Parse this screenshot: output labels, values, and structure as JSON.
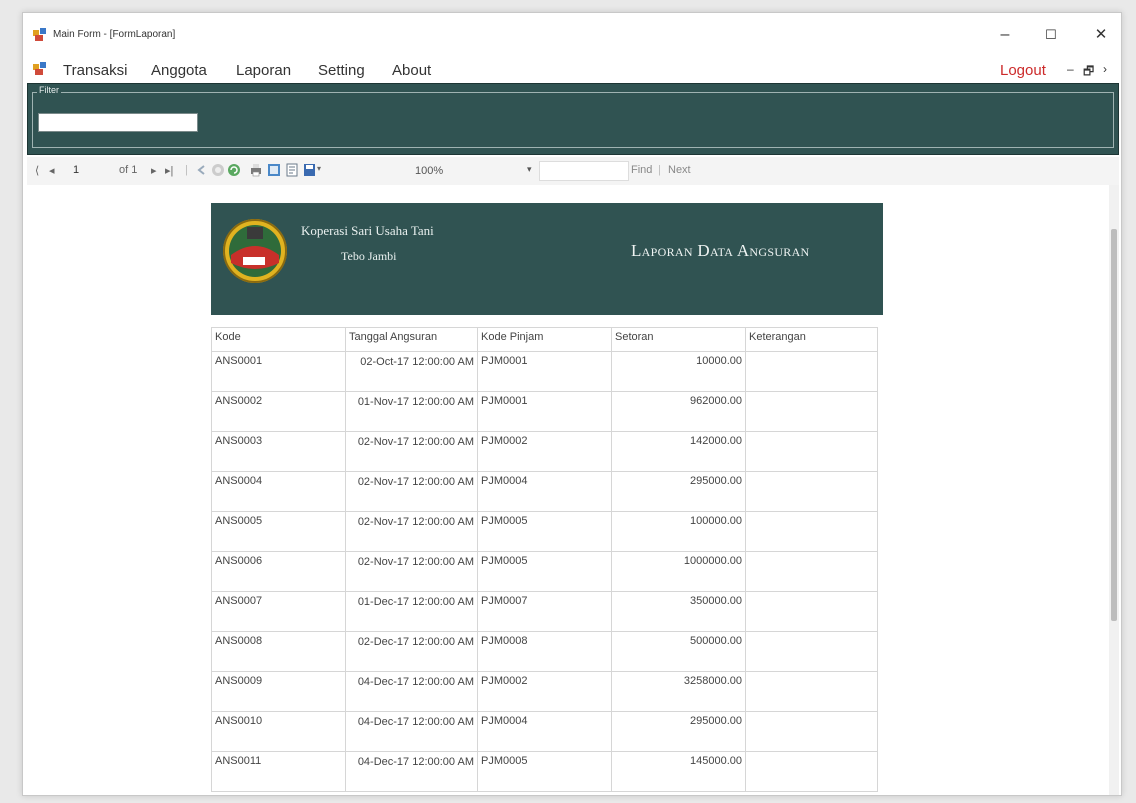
{
  "window": {
    "title": "Main Form - [FormLaporan]",
    "buttons": {
      "minimize": "–",
      "maximize": "☐",
      "close": "✕"
    }
  },
  "menu": {
    "items": [
      "Transaksi",
      "Anggota",
      "Laporan",
      "Setting",
      "About"
    ],
    "logout": "Logout",
    "mdi_controls": {
      "minimize": "–",
      "restore": "🗗",
      "close": "›"
    }
  },
  "filter": {
    "label": "Filter",
    "value": ""
  },
  "toolbar": {
    "first": "⟨",
    "prev": "◂",
    "page": "1",
    "page_of": "of 1",
    "next": "▸",
    "last": "▸|",
    "zoom": "100%",
    "find_label": "Find",
    "next_label": "Next",
    "separator": "|"
  },
  "report": {
    "org_name": "Koperasi Sari Usaha Tani",
    "org_city": "Tebo Jambi",
    "title": "Laporan Data Angsuran",
    "columns": [
      "Kode",
      "Tanggal Angsuran",
      "Kode Pinjam",
      "Setoran",
      "Keterangan"
    ],
    "rows": [
      {
        "kode": "ANS0001",
        "tanggal": "02-Oct-17 12:00:00 AM",
        "pinjam": "PJM0001",
        "setoran": "10000.00",
        "ket": ""
      },
      {
        "kode": "ANS0002",
        "tanggal": "01-Nov-17 12:00:00 AM",
        "pinjam": "PJM0001",
        "setoran": "962000.00",
        "ket": ""
      },
      {
        "kode": "ANS0003",
        "tanggal": "02-Nov-17 12:00:00 AM",
        "pinjam": "PJM0002",
        "setoran": "142000.00",
        "ket": ""
      },
      {
        "kode": "ANS0004",
        "tanggal": "02-Nov-17 12:00:00 AM",
        "pinjam": "PJM0004",
        "setoran": "295000.00",
        "ket": ""
      },
      {
        "kode": "ANS0005",
        "tanggal": "02-Nov-17 12:00:00 AM",
        "pinjam": "PJM0005",
        "setoran": "100000.00",
        "ket": ""
      },
      {
        "kode": "ANS0006",
        "tanggal": "02-Nov-17 12:00:00 AM",
        "pinjam": "PJM0005",
        "setoran": "1000000.00",
        "ket": ""
      },
      {
        "kode": "ANS0007",
        "tanggal": "01-Dec-17 12:00:00 AM",
        "pinjam": "PJM0007",
        "setoran": "350000.00",
        "ket": ""
      },
      {
        "kode": "ANS0008",
        "tanggal": "02-Dec-17 12:00:00 AM",
        "pinjam": "PJM0008",
        "setoran": "500000.00",
        "ket": ""
      },
      {
        "kode": "ANS0009",
        "tanggal": "04-Dec-17 12:00:00 AM",
        "pinjam": "PJM0002",
        "setoran": "3258000.00",
        "ket": ""
      },
      {
        "kode": "ANS0010",
        "tanggal": "04-Dec-17 12:00:00 AM",
        "pinjam": "PJM0004",
        "setoran": "295000.00",
        "ket": ""
      },
      {
        "kode": "ANS0011",
        "tanggal": "04-Dec-17 12:00:00 AM",
        "pinjam": "PJM0005",
        "setoran": "145000.00",
        "ket": ""
      }
    ]
  },
  "colors": {
    "panel": "#305352",
    "logout": "#cc2a2a",
    "header_text": "#eef3f2"
  }
}
